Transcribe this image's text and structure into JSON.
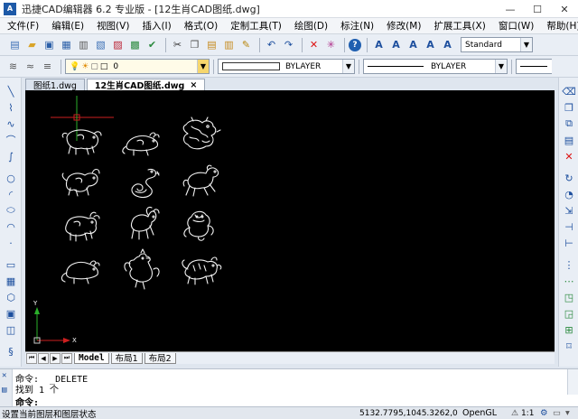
{
  "app": {
    "title": "迅捷CAD编辑器 6.2 专业版 - [12生肖CAD图纸.dwg]",
    "logo_text": "A",
    "win_minimize": "—",
    "win_maximize": "☐",
    "win_close": "✕"
  },
  "menu": [
    "文件(F)",
    "编辑(E)",
    "视图(V)",
    "插入(I)",
    "格式(O)",
    "定制工具(T)",
    "绘图(D)",
    "标注(N)",
    "修改(M)",
    "扩展工具(X)",
    "窗口(W)",
    "帮助(H)"
  ],
  "toolbar": {
    "text_style": "Standard",
    "layer_value": "0",
    "color_value": "BYLAYER",
    "linetype_value": "BYLAYER"
  },
  "doc_tabs": [
    {
      "label": "图纸1.dwg",
      "active": false
    },
    {
      "label": "12生肖CAD图纸.dwg",
      "active": true,
      "close": "×"
    }
  ],
  "canvas": {
    "background": "#000000",
    "crosshair_color": "#cc1f1f",
    "y_axis_label": "Y",
    "x_axis_label": "X",
    "animals": [
      "pig",
      "rat",
      "dragon",
      "dog",
      "snake",
      "horse",
      "ox",
      "goat",
      "monkey",
      "rat-2",
      "rooster",
      "tiger"
    ]
  },
  "layout_tabs": [
    {
      "label": "Model",
      "active": true
    },
    {
      "label": "布局1",
      "active": false
    },
    {
      "label": "布局2",
      "active": false
    }
  ],
  "command": {
    "line1": "命令:  _DELETE",
    "line2": "找到 1 个",
    "prompt": "命令:"
  },
  "status": {
    "message": "设置当前图层和图层状态",
    "coords": "5132.7795,1045.3262,0",
    "render_mode": "OpenGL",
    "scale": "1:1"
  }
}
